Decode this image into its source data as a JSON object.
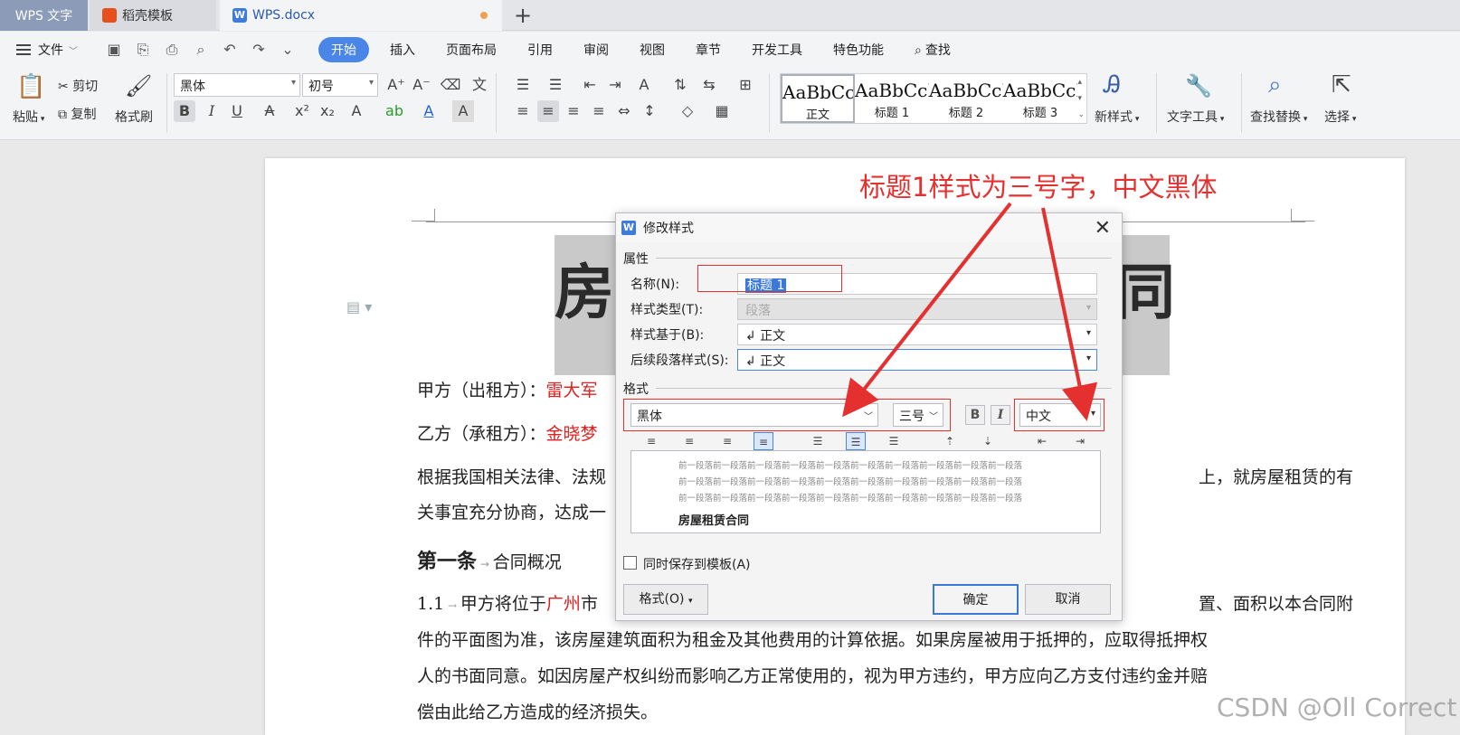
{
  "tabs": {
    "app": "WPS 文字",
    "template": "稻壳模板",
    "doc": "WPS.docx"
  },
  "menu": {
    "file": "文件",
    "items": [
      "开始",
      "插入",
      "页面布局",
      "引用",
      "审阅",
      "视图",
      "章节",
      "开发工具",
      "特色功能",
      "查找"
    ]
  },
  "ribbon": {
    "paste": "粘贴",
    "cut": "剪切",
    "copy": "复制",
    "format_painter": "格式刷",
    "font": "黑体",
    "size": "初号",
    "styles": [
      {
        "sample": "AaBbCcDd",
        "name": "正文"
      },
      {
        "sample": "AaBbCcDd",
        "name": "标题 1"
      },
      {
        "sample": "AaBbCcDd",
        "name": "标题 2"
      },
      {
        "sample": "AaBbCcDd",
        "name": "标题 3"
      }
    ],
    "new_style": "新样式",
    "text_tools": "文字工具",
    "find_replace": "查找替换",
    "select": "选择"
  },
  "document": {
    "title_left": "房",
    "title_right": "同",
    "party_a_label": "甲方（出租方）：",
    "party_a_name": "雷大军",
    "party_b_label": "乙方（承租方）：",
    "party_b_name": "金晓梦",
    "para1_left": "根据我国相关法律、法规",
    "para1_right": "上，就房屋租赁的有",
    "para2": "关事宜充分协商，达成一",
    "article1": "第一条",
    "article1_title": "合同概况",
    "clause_num": "1.1",
    "clause_left": "甲方将位于",
    "clause_city": "广州",
    "clause_mid": "市",
    "clause_right": "置、面积以本合同附",
    "line2": "件的平面图为准，该房屋建筑面积为租金及其他费用的计算依据。如果房屋被用于抵押的，应取得抵押权",
    "line3": "人的书面同意。如因房屋产权纠纷而影响乙方正常使用的，视为甲方违约，甲方应向乙方支付违约金并赔",
    "line4": "偿由此给乙方造成的经济损失。"
  },
  "dialog": {
    "title": "修改样式",
    "section_props": "属性",
    "name_label": "名称(N):",
    "name_value": "标题 1",
    "type_label": "样式类型(T):",
    "type_value": "段落",
    "based_label": "样式基于(B):",
    "based_value": "↲ 正文",
    "next_label": "后续段落样式(S):",
    "next_value": "↲ 正文",
    "section_format": "格式",
    "font_value": "黑体",
    "size_value": "三号",
    "bold_label": "B",
    "italic_label": "I",
    "lang_value": "中文",
    "preview_prev": "前一段落前一段落前一段落前一段落前一段落前一段落前一段落前一段落前一段落前一段落",
    "preview_cur": "房屋租赁合同",
    "save_template": "同时保存到模板(A)",
    "format_btn": "格式(O)",
    "ok": "确定",
    "cancel": "取消"
  },
  "annotation": "标题1样式为三号字，中文黑体",
  "watermark": "CSDN @Oll Correct",
  "colors": {
    "accent": "#4a86e8",
    "annotation": "#e53030"
  }
}
